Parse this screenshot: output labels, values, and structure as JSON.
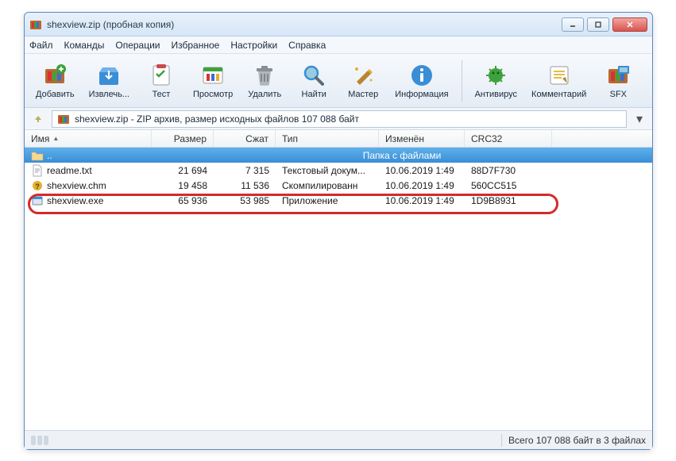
{
  "title": "shexview.zip (пробная копия)",
  "menu": {
    "items": [
      "Файл",
      "Команды",
      "Операции",
      "Избранное",
      "Настройки",
      "Справка"
    ]
  },
  "toolbar": {
    "add": "Добавить",
    "extract": "Извлечь...",
    "test": "Тест",
    "view": "Просмотр",
    "delete": "Удалить",
    "find": "Найти",
    "wizard": "Мастер",
    "info": "Информация",
    "antivirus": "Антивирус",
    "comment": "Комментарий",
    "sfx": "SFX"
  },
  "pathbar": {
    "text": "shexview.zip - ZIP архив, размер исходных файлов 107 088 байт"
  },
  "columns": {
    "name": "Имя",
    "size": "Размер",
    "packed": "Сжат",
    "type": "Тип",
    "modified": "Изменён",
    "crc": "CRC32"
  },
  "parent_row": {
    "name": "..",
    "type": "Папка с файлами"
  },
  "rows": [
    {
      "name": "readme.txt",
      "size": "21 694",
      "packed": "7 315",
      "type": "Текстовый докум...",
      "modified": "10.06.2019 1:49",
      "crc": "88D7F730"
    },
    {
      "name": "shexview.chm",
      "size": "19 458",
      "packed": "11 536",
      "type": "Скомпилированн",
      "modified": "10.06.2019 1:49",
      "crc": "560CC515"
    },
    {
      "name": "shexview.exe",
      "size": "65 936",
      "packed": "53 985",
      "type": "Приложение",
      "modified": "10.06.2019 1:49",
      "crc": "1D9B8931"
    }
  ],
  "status": {
    "total": "Всего  107 088 байт в 3 файлах"
  }
}
